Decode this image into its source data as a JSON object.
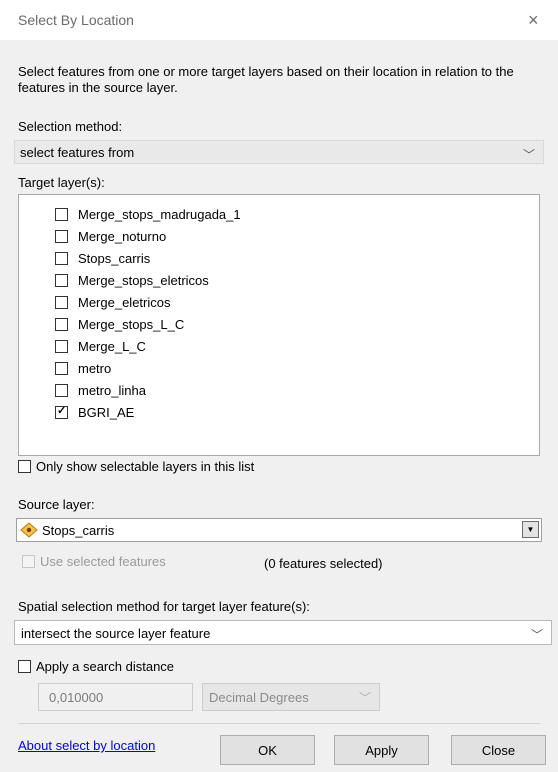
{
  "window": {
    "title": "Select By Location",
    "close_glyph": "×"
  },
  "description": "Select features from one or more target layers based on their location in relation to the features in the source layer.",
  "selection_method": {
    "label": "Selection method:",
    "value": "select features from"
  },
  "target_layers": {
    "label": "Target layer(s):",
    "items": [
      {
        "label": "Merge_stops_madrugada_1",
        "checked": false
      },
      {
        "label": "Merge_noturno",
        "checked": false
      },
      {
        "label": "Stops_carris",
        "checked": false
      },
      {
        "label": "Merge_stops_eletricos",
        "checked": false
      },
      {
        "label": "Merge_eletricos",
        "checked": false
      },
      {
        "label": "Merge_stops_L_C",
        "checked": false
      },
      {
        "label": "Merge_L_C",
        "checked": false
      },
      {
        "label": "metro",
        "checked": false
      },
      {
        "label": "metro_linha",
        "checked": false
      },
      {
        "label": "BGRI_AE",
        "checked": true
      }
    ]
  },
  "only_selectable": {
    "label": "Only show selectable layers in this list",
    "checked": false
  },
  "source_layer": {
    "label": "Source layer:",
    "value": "Stops_carris",
    "use_selected_label": "Use selected features",
    "features_selected": "(0 features selected)"
  },
  "spatial_method": {
    "label": "Spatial selection method for target layer feature(s):",
    "value": "intersect the source layer feature"
  },
  "search_distance": {
    "label": "Apply a search distance",
    "checked": false,
    "value": "0,010000",
    "units": "Decimal Degrees"
  },
  "footer": {
    "help_link": "About select by location",
    "ok": "OK",
    "apply": "Apply",
    "close": "Close"
  },
  "colors": {
    "link": "#0000ee",
    "background": "#f0f0f0",
    "titlebar": "#ffffff"
  }
}
